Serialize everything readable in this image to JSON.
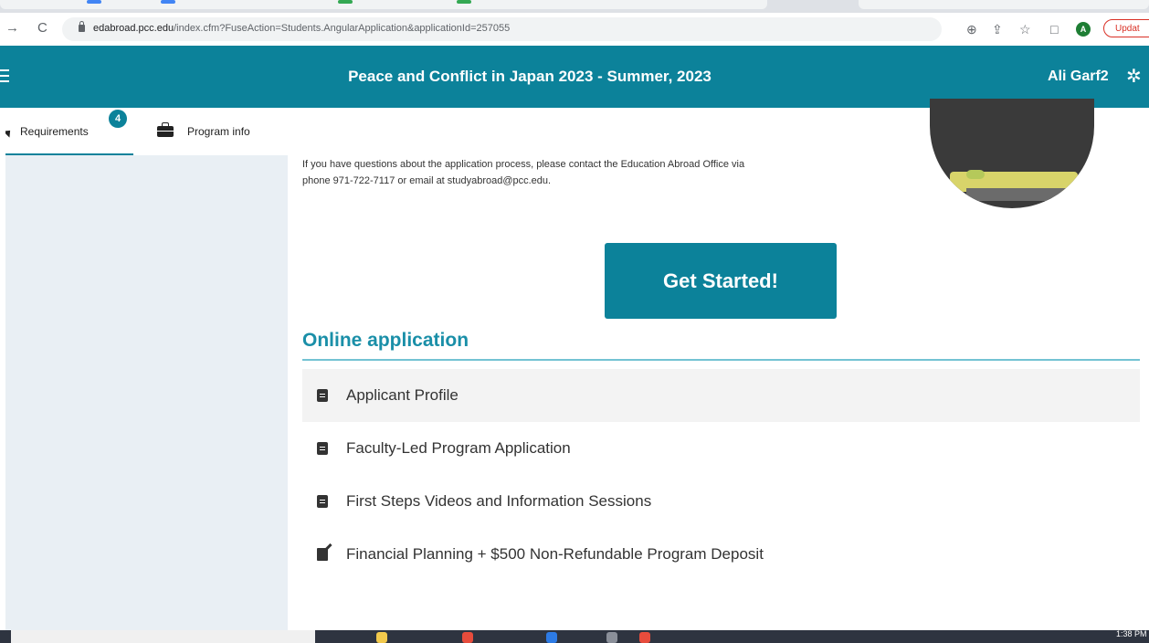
{
  "browser": {
    "url_host": "edabroad.pcc.edu",
    "url_path": "/index.cfm?FuseAction=Students.AngularApplication&applicationId=257055",
    "profile_initial": "A",
    "update_label": "Updat"
  },
  "header": {
    "title": "Peace and Conflict in Japan 2023 - Summer, 2023",
    "user": "Ali Garf2"
  },
  "tabs": [
    {
      "label": "Requirements",
      "badge": "4"
    },
    {
      "label": "Program info"
    }
  ],
  "main": {
    "intro": "If you have questions about the application process, please contact the Education Abroad Office via phone 971-722-7117 or email at studyabroad@pcc.edu.",
    "cta_label": "Get Started!",
    "section_title": "Online application",
    "items": [
      {
        "label": "Applicant Profile",
        "icon": "document-icon"
      },
      {
        "label": "Faculty-Led Program Application",
        "icon": "play-document-icon"
      },
      {
        "label": "First Steps Videos and Information Sessions",
        "icon": "book-icon"
      },
      {
        "label": "Financial Planning + $500 Non-Refundable Program Deposit",
        "icon": "signature-icon"
      }
    ]
  },
  "taskbar": {
    "clock": "1:38 PM"
  },
  "colors": {
    "brand": "#0c829a",
    "section_title": "#1a8fa8",
    "sidebar_bg": "#e9eff4"
  }
}
